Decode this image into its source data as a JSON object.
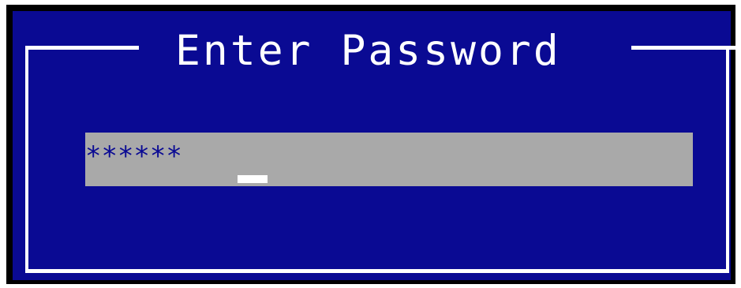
{
  "dialog": {
    "title": "Enter Password",
    "password_value": "******",
    "colors": {
      "background": "#0a0a93",
      "border": "#ffffff",
      "field": "#a9a9a9",
      "text": "#0a0a93"
    }
  }
}
